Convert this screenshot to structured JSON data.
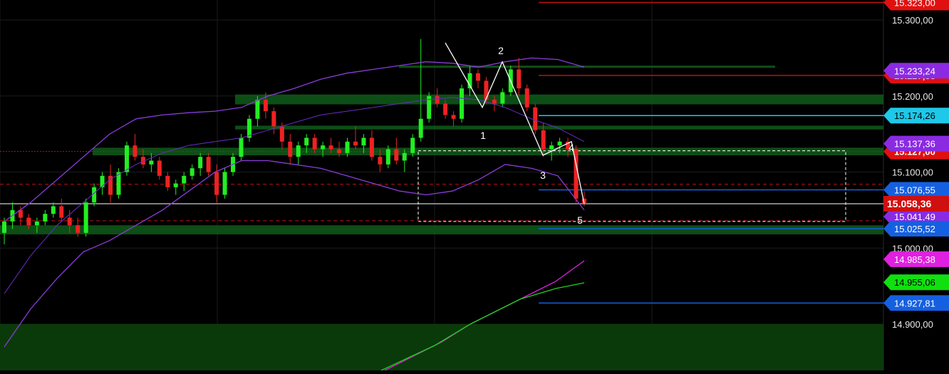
{
  "chart_data": {
    "type": "candlestick",
    "ylim": [
      14870,
      15330
    ],
    "grid": true,
    "price_scale": {
      "ticks": [
        "15.300,00",
        "15.200,00",
        "15.100,00",
        "15.000,00",
        "14.900,00"
      ],
      "tick_values": [
        15300,
        15200,
        15100,
        15000,
        14900
      ]
    },
    "last_price": {
      "label": "15.058,36",
      "value": 15058.36,
      "color": "#d01010"
    },
    "price_tags": [
      {
        "label": "15.323,00",
        "value": 15323.0,
        "color": "#e01010"
      },
      {
        "label": "15.233,24",
        "value": 15233.24,
        "color": "#8a2be2"
      },
      {
        "label": "15.174,26",
        "value": 15174.26,
        "color": "#1ec8e8"
      },
      {
        "label": "15.137,36",
        "value": 15137.36,
        "color": "#8a2be2"
      },
      {
        "label": "15.076,55",
        "value": 15076.55,
        "color": "#1560e0"
      },
      {
        "label": "15.041,49",
        "value": 15041.49,
        "color": "#8a2be2"
      },
      {
        "label": "15.025,52",
        "value": 15025.52,
        "color": "#1560e0"
      },
      {
        "label": "14.985,38",
        "value": 14985.38,
        "color": "#e020e0"
      },
      {
        "label": "14.955,06",
        "value": 14955.06,
        "color": "#10e010"
      },
      {
        "label": "14.927,81",
        "value": 14927.81,
        "color": "#1560e0"
      }
    ],
    "hidden_tags": [
      {
        "label": "15.227,33",
        "value": 15227,
        "color": "#e01010"
      },
      {
        "label": "15.127,00",
        "value": 15127,
        "color": "#e01010"
      }
    ],
    "elliott_wave": {
      "labels": [
        "1",
        "2",
        "3",
        "4",
        "5"
      ],
      "points": [
        15188,
        15250,
        15122,
        15143,
        15058
      ]
    },
    "candles": [
      [
        15020,
        15040,
        15005,
        15035
      ],
      [
        15035,
        15060,
        15025,
        15050
      ],
      [
        15050,
        15055,
        15030,
        15040
      ],
      [
        15040,
        15045,
        15025,
        15030
      ],
      [
        15030,
        15040,
        15020,
        15035
      ],
      [
        15035,
        15050,
        15030,
        15045
      ],
      [
        15045,
        15060,
        15040,
        15055
      ],
      [
        15055,
        15065,
        15035,
        15040
      ],
      [
        15040,
        15050,
        15020,
        15030
      ],
      [
        15030,
        15040,
        15015,
        15020
      ],
      [
        15020,
        15065,
        15015,
        15060
      ],
      [
        15060,
        15085,
        15055,
        15080
      ],
      [
        15080,
        15100,
        15070,
        15095
      ],
      [
        15095,
        15110,
        15060,
        15070
      ],
      [
        15070,
        15105,
        15065,
        15100
      ],
      [
        15100,
        15140,
        15095,
        15135
      ],
      [
        15135,
        15150,
        15115,
        15120
      ],
      [
        15120,
        15130,
        15105,
        15110
      ],
      [
        15110,
        15125,
        15100,
        15115
      ],
      [
        15115,
        15120,
        15090,
        15095
      ],
      [
        15095,
        15100,
        15075,
        15080
      ],
      [
        15080,
        15090,
        15070,
        15085
      ],
      [
        15085,
        15100,
        15075,
        15095
      ],
      [
        15095,
        15110,
        15090,
        15105
      ],
      [
        15105,
        15125,
        15095,
        15120
      ],
      [
        15120,
        15125,
        15095,
        15100
      ],
      [
        15100,
        15110,
        15060,
        15070
      ],
      [
        15070,
        15105,
        15065,
        15100
      ],
      [
        15100,
        15125,
        15095,
        15120
      ],
      [
        15120,
        15150,
        15115,
        15145
      ],
      [
        15145,
        15175,
        15140,
        15170
      ],
      [
        15170,
        15200,
        15160,
        15195
      ],
      [
        15195,
        15205,
        15170,
        15180
      ],
      [
        15180,
        15185,
        15150,
        15160
      ],
      [
        15160,
        15165,
        15130,
        15140
      ],
      [
        15140,
        15150,
        15110,
        15120
      ],
      [
        15120,
        15140,
        15110,
        15135
      ],
      [
        15135,
        15150,
        15125,
        15145
      ],
      [
        15145,
        15150,
        15125,
        15130
      ],
      [
        15130,
        15140,
        15120,
        15135
      ],
      [
        15135,
        15145,
        15125,
        15130
      ],
      [
        15130,
        15140,
        15120,
        15125
      ],
      [
        15125,
        15145,
        15120,
        15140
      ],
      [
        15140,
        15160,
        15130,
        15135
      ],
      [
        15135,
        15150,
        15125,
        15145
      ],
      [
        15145,
        15155,
        15115,
        15120
      ],
      [
        15120,
        15130,
        15100,
        15110
      ],
      [
        15110,
        15135,
        15105,
        15130
      ],
      [
        15130,
        15145,
        15110,
        15115
      ],
      [
        15115,
        15130,
        15100,
        15125
      ],
      [
        15125,
        15150,
        15120,
        15145
      ],
      [
        15145,
        15275,
        15140,
        15170
      ],
      [
        15170,
        15205,
        15165,
        15200
      ],
      [
        15200,
        15210,
        15185,
        15190
      ],
      [
        15190,
        15195,
        15170,
        15175
      ],
      [
        15175,
        15180,
        15160,
        15170
      ],
      [
        15170,
        15215,
        15165,
        15210
      ],
      [
        15210,
        15240,
        15200,
        15230
      ],
      [
        15230,
        15235,
        15210,
        15220
      ],
      [
        15220,
        15225,
        15190,
        15195
      ],
      [
        15195,
        15200,
        15180,
        15190
      ],
      [
        15190,
        15210,
        15185,
        15205
      ],
      [
        15205,
        15240,
        15200,
        15235
      ],
      [
        15235,
        15250,
        15200,
        15210
      ],
      [
        15210,
        15215,
        15180,
        15185
      ],
      [
        15185,
        15190,
        15150,
        15155
      ],
      [
        15155,
        15165,
        15120,
        15130
      ],
      [
        15130,
        15140,
        15115,
        15135
      ],
      [
        15135,
        15145,
        15125,
        15140
      ],
      [
        15140,
        15145,
        15120,
        15130
      ],
      [
        15130,
        15135,
        15060,
        15065
      ],
      [
        15065,
        15075,
        15055,
        15058.36
      ]
    ],
    "indicator_notes": [
      "bollinger bands (purple)",
      "moving averages (magenta, green)",
      "support/resistance zones (dark green)"
    ]
  }
}
